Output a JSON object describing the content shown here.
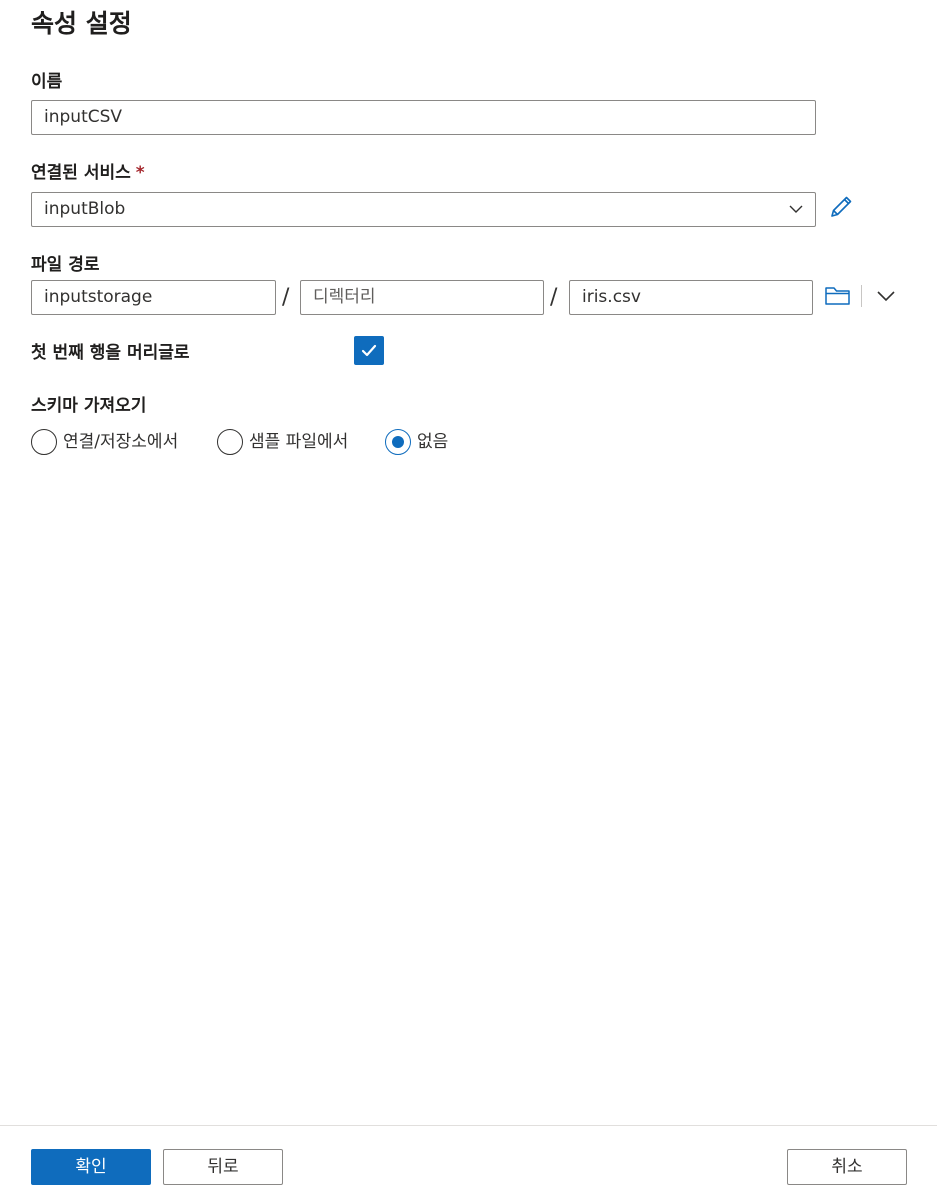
{
  "panel": {
    "title": "속성 설정"
  },
  "name_field": {
    "label": "이름",
    "value": "inputCSV"
  },
  "linked_service": {
    "label": "연결된 서비스",
    "required_mark": "*",
    "selected": "inputBlob",
    "edit_icon": "pencil-icon",
    "chevron_icon": "chevron-down-icon"
  },
  "file_path": {
    "label": "파일 경로",
    "container": "inputstorage",
    "separator": "/",
    "directory_placeholder": "디렉터리",
    "file": "iris.csv",
    "browse_icon": "folder-icon",
    "more_icon": "chevron-down-icon"
  },
  "first_row_header": {
    "label": "첫 번째 행을 머리글로",
    "checked": true
  },
  "import_schema": {
    "label": "스키마 가져오기",
    "options": [
      {
        "label": "연결/저장소에서",
        "selected": false
      },
      {
        "label": "샘플 파일에서",
        "selected": false
      },
      {
        "label": "없음",
        "selected": true
      }
    ]
  },
  "footer": {
    "ok_label": "확인",
    "back_label": "뒤로",
    "cancel_label": "취소"
  },
  "colors": {
    "accent": "#0f6cbd",
    "required": "#a4262c"
  }
}
